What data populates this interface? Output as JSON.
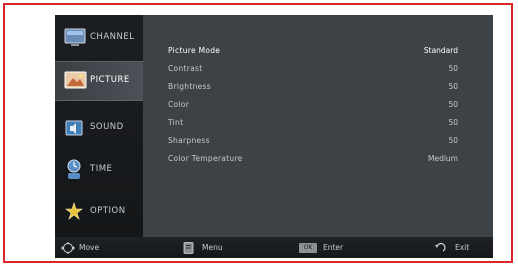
{
  "menu": {
    "items": [
      {
        "label": "CHANNEL",
        "icon": "channel-icon"
      },
      {
        "label": "PICTURE",
        "icon": "picture-icon",
        "selected": true
      },
      {
        "label": "SOUND",
        "icon": "sound-icon"
      },
      {
        "label": "TIME",
        "icon": "time-icon"
      },
      {
        "label": "OPTION",
        "icon": "option-icon"
      }
    ]
  },
  "settings": [
    {
      "label": "Picture Mode",
      "value": "Standard"
    },
    {
      "label": "Contrast",
      "value": "50"
    },
    {
      "label": "Brightness",
      "value": "50"
    },
    {
      "label": "Color",
      "value": "50"
    },
    {
      "label": "Tint",
      "value": "50"
    },
    {
      "label": "Sharpness",
      "value": "50"
    },
    {
      "label": "Color Temperature",
      "value": "Medium"
    }
  ],
  "footer": {
    "move": "Move",
    "menu": "Menu",
    "enter_key": "OK",
    "enter": "Enter",
    "exit": "Exit"
  },
  "colors": {
    "frame": "#d8262b",
    "panel": "#3c4246",
    "sidebar": "#1c1f22"
  }
}
